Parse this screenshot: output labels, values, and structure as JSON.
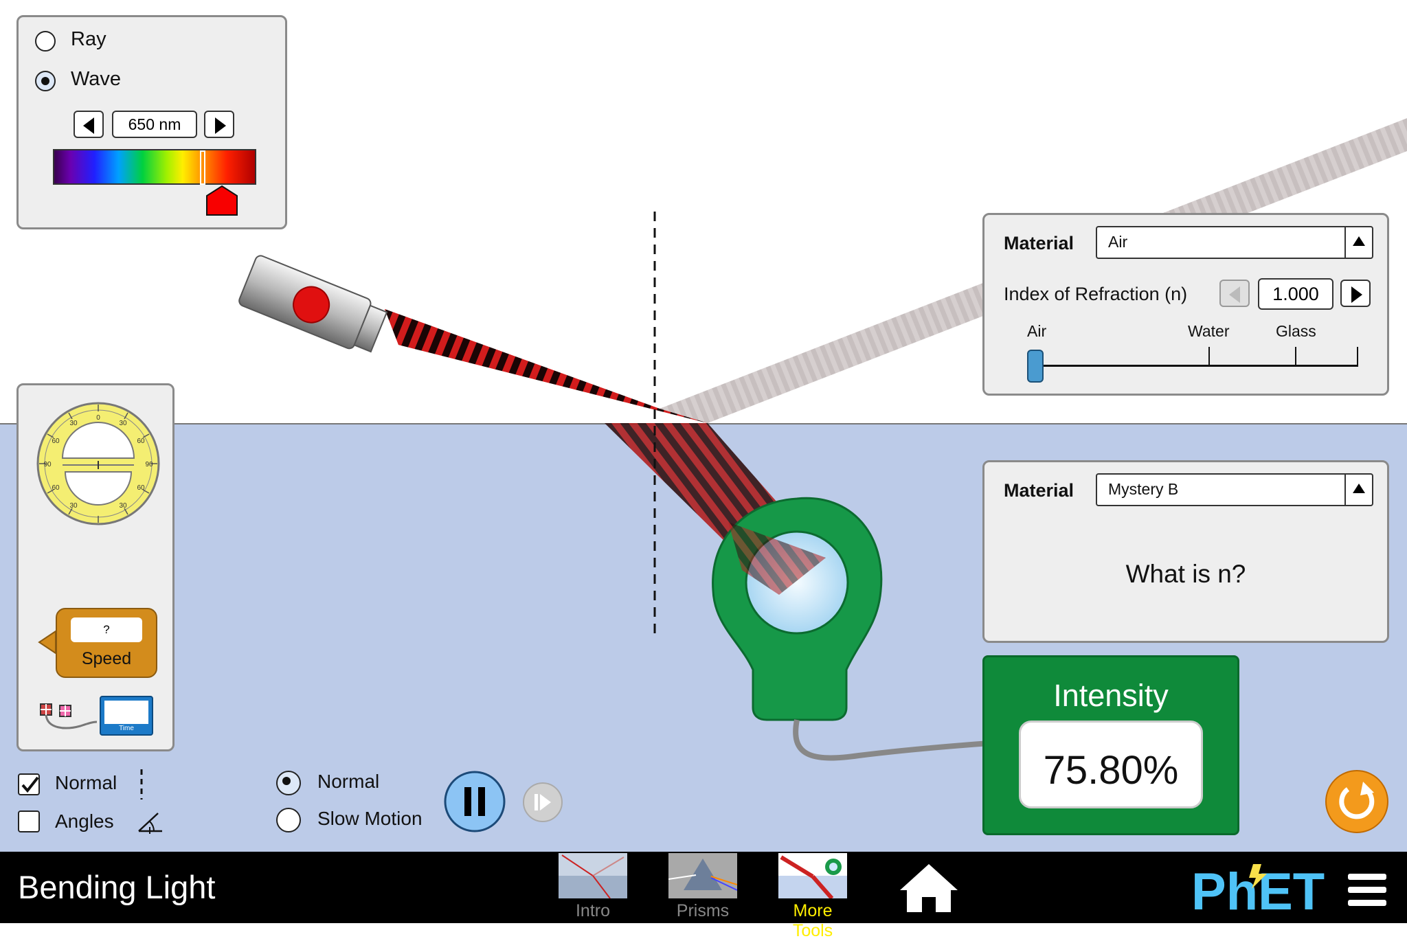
{
  "app": {
    "title": "Bending Light"
  },
  "light_panel": {
    "mode_options": [
      "Ray",
      "Wave"
    ],
    "selected_mode": "Wave",
    "wavelength": "650 nm"
  },
  "top_material": {
    "label": "Material",
    "selected": "Air",
    "index_label": "Index of Refraction (n)",
    "index_value": "1.000",
    "slider_labels": [
      "Air",
      "Water",
      "Glass"
    ],
    "slider_level_fraction": 0.0
  },
  "bottom_material": {
    "label": "Material",
    "selected": "Mystery B",
    "question": "What is n?"
  },
  "intensity": {
    "title": "Intensity",
    "value": "75.80%"
  },
  "toolbox": {
    "protractor_marks": [
      "0",
      "30",
      "60",
      "90",
      "60",
      "30",
      "30",
      "60",
      "90",
      "60",
      "30"
    ],
    "speed_value": "?",
    "speed_label": "Speed",
    "timer_label": "Time"
  },
  "view_options": {
    "normal_label": "Normal",
    "normal_checked": true,
    "angles_label": "Angles",
    "angles_checked": false
  },
  "speed_options": {
    "options": [
      "Normal",
      "Slow Motion"
    ],
    "selected": "Normal"
  },
  "navigation": {
    "tabs": [
      {
        "label": "Intro",
        "active": false
      },
      {
        "label": "Prisms",
        "active": false
      },
      {
        "label": "More Tools",
        "active": true
      }
    ],
    "home_label": "Home",
    "brand": "PhET"
  },
  "colors": {
    "beam": "#c81414",
    "medium_bottom": "#bccbe8",
    "intensity_bg": "#0f8a3a",
    "reset_button": "#f39a1c",
    "active_tab_text": "#ffee00"
  }
}
